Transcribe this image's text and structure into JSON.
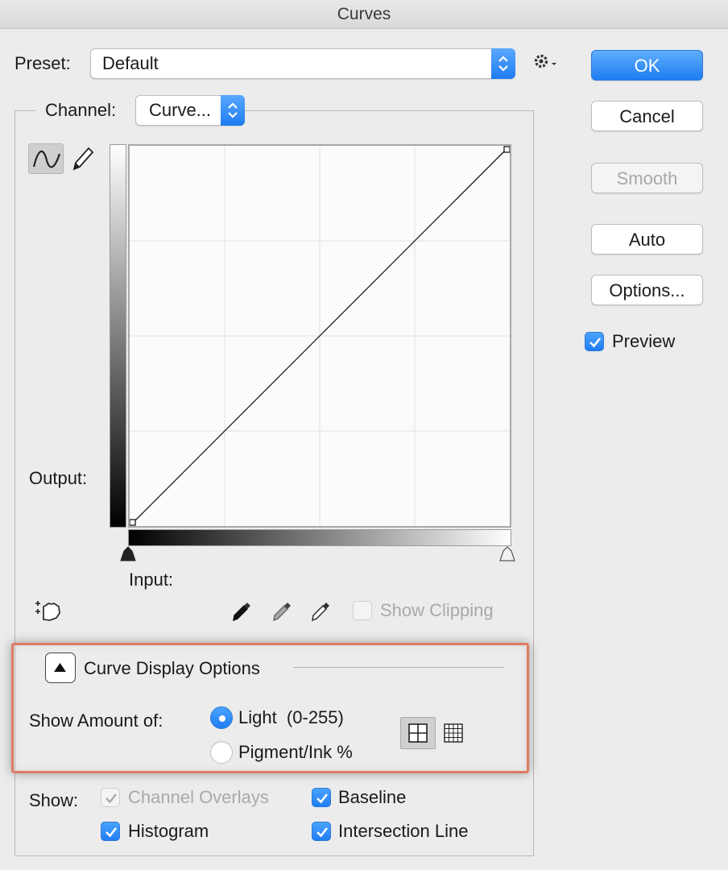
{
  "window": {
    "title": "Curves"
  },
  "preset": {
    "label": "Preset:",
    "value": "Default"
  },
  "channel": {
    "label": "Channel:",
    "value": "Curve..."
  },
  "buttons": {
    "ok": "OK",
    "cancel": "Cancel",
    "smooth": "Smooth",
    "auto": "Auto",
    "options": "Options..."
  },
  "preview": {
    "label": "Preview",
    "checked": true
  },
  "graph": {
    "output_label": "Output:",
    "input_label": "Input:"
  },
  "show_clipping": {
    "label": "Show Clipping",
    "checked": false
  },
  "curve_display": {
    "title": "Curve Display Options",
    "show_amount_label": "Show Amount of:",
    "options": [
      {
        "label": "Light  (0-255)",
        "selected": true
      },
      {
        "label": "Pigment/Ink %",
        "selected": false
      }
    ]
  },
  "show": {
    "label": "Show:",
    "items": [
      {
        "label": "Channel Overlays",
        "checked": true,
        "enabled": false
      },
      {
        "label": "Baseline",
        "checked": true,
        "enabled": true
      },
      {
        "label": "Histogram",
        "checked": true,
        "enabled": true
      },
      {
        "label": "Intersection Line",
        "checked": true,
        "enabled": true
      }
    ]
  },
  "colors": {
    "accent": "#1f7df3",
    "highlight_frame": "#e07a62"
  }
}
